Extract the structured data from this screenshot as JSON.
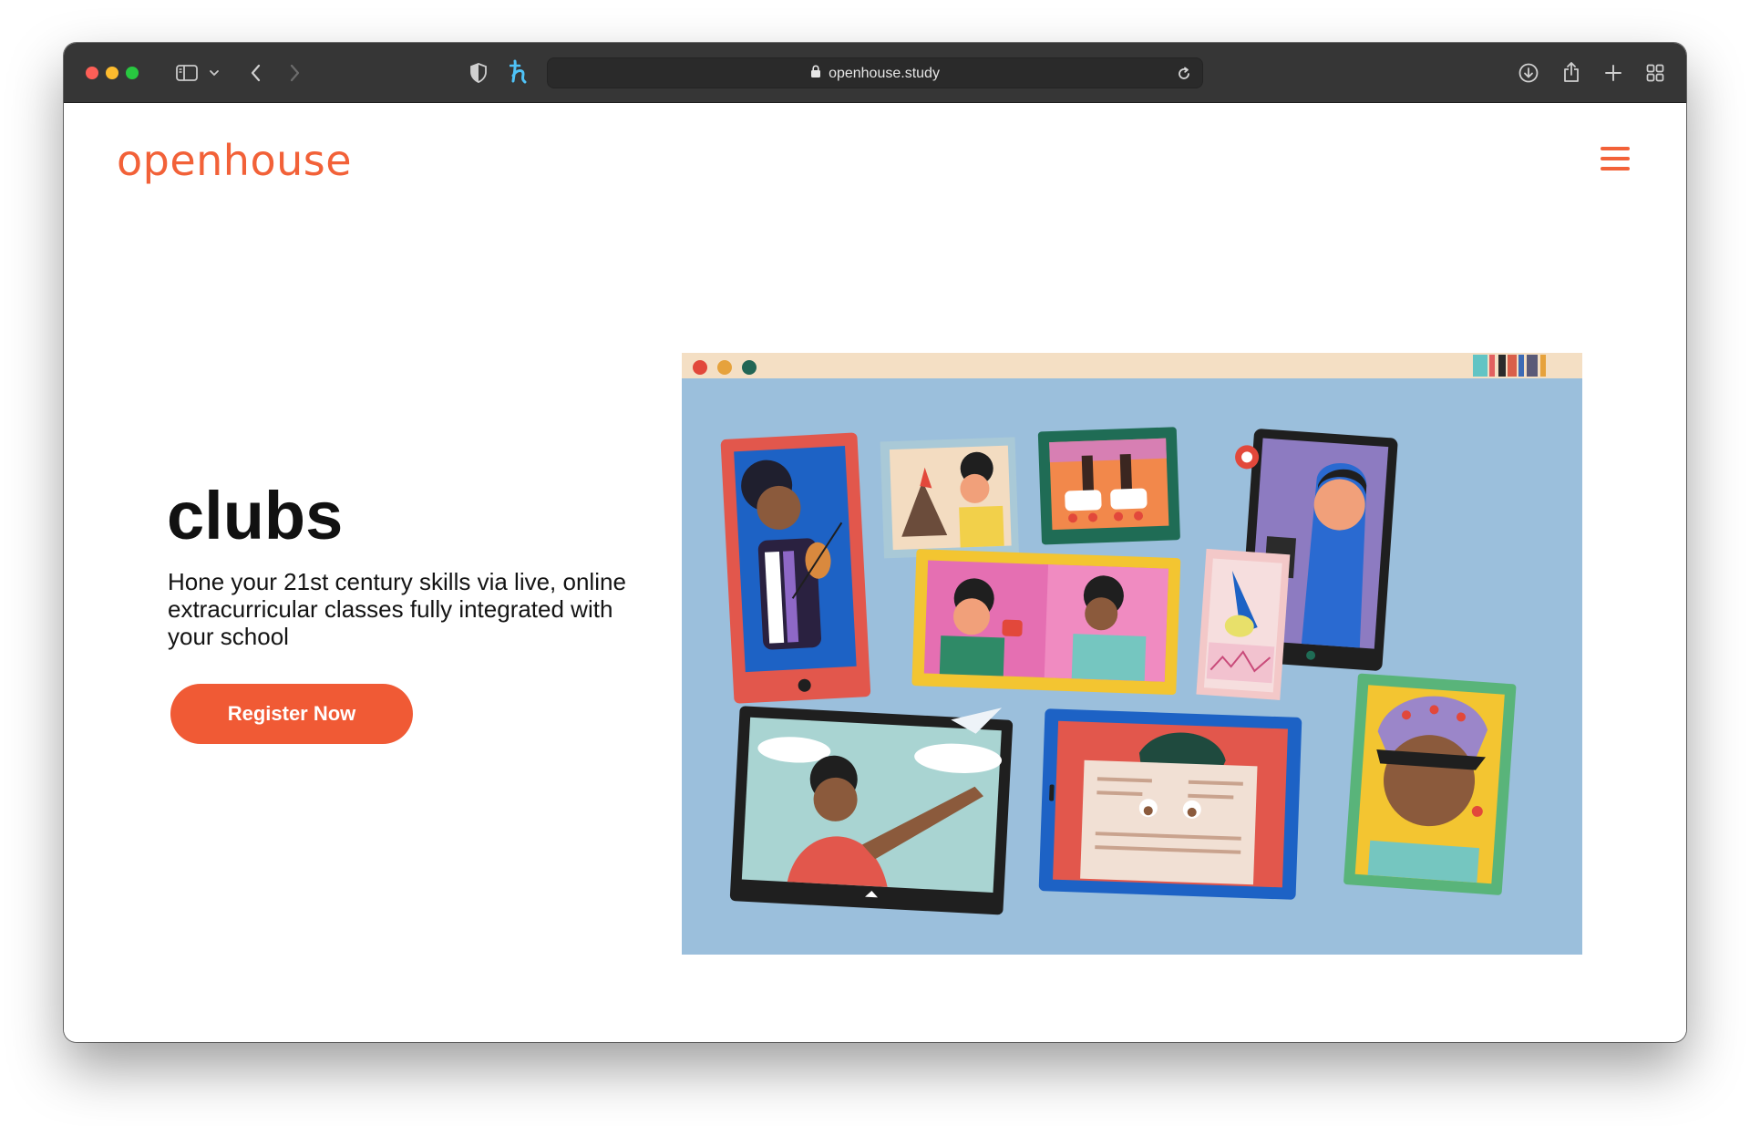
{
  "browser": {
    "url": "openhouse.study"
  },
  "site": {
    "logo_text": "openhouse",
    "menu_icon": "hamburger-menu-icon"
  },
  "hero": {
    "title": "clubs",
    "subtitle": "Hone your 21st century skills via live, online extracurricular classes fully integrated with your school",
    "cta_label": "Register Now"
  },
  "colors": {
    "brand": "#f26138",
    "cta": "#f05a35",
    "illustration_bg": "#9bbfdc",
    "illustration_header": "#f4dfc4"
  }
}
